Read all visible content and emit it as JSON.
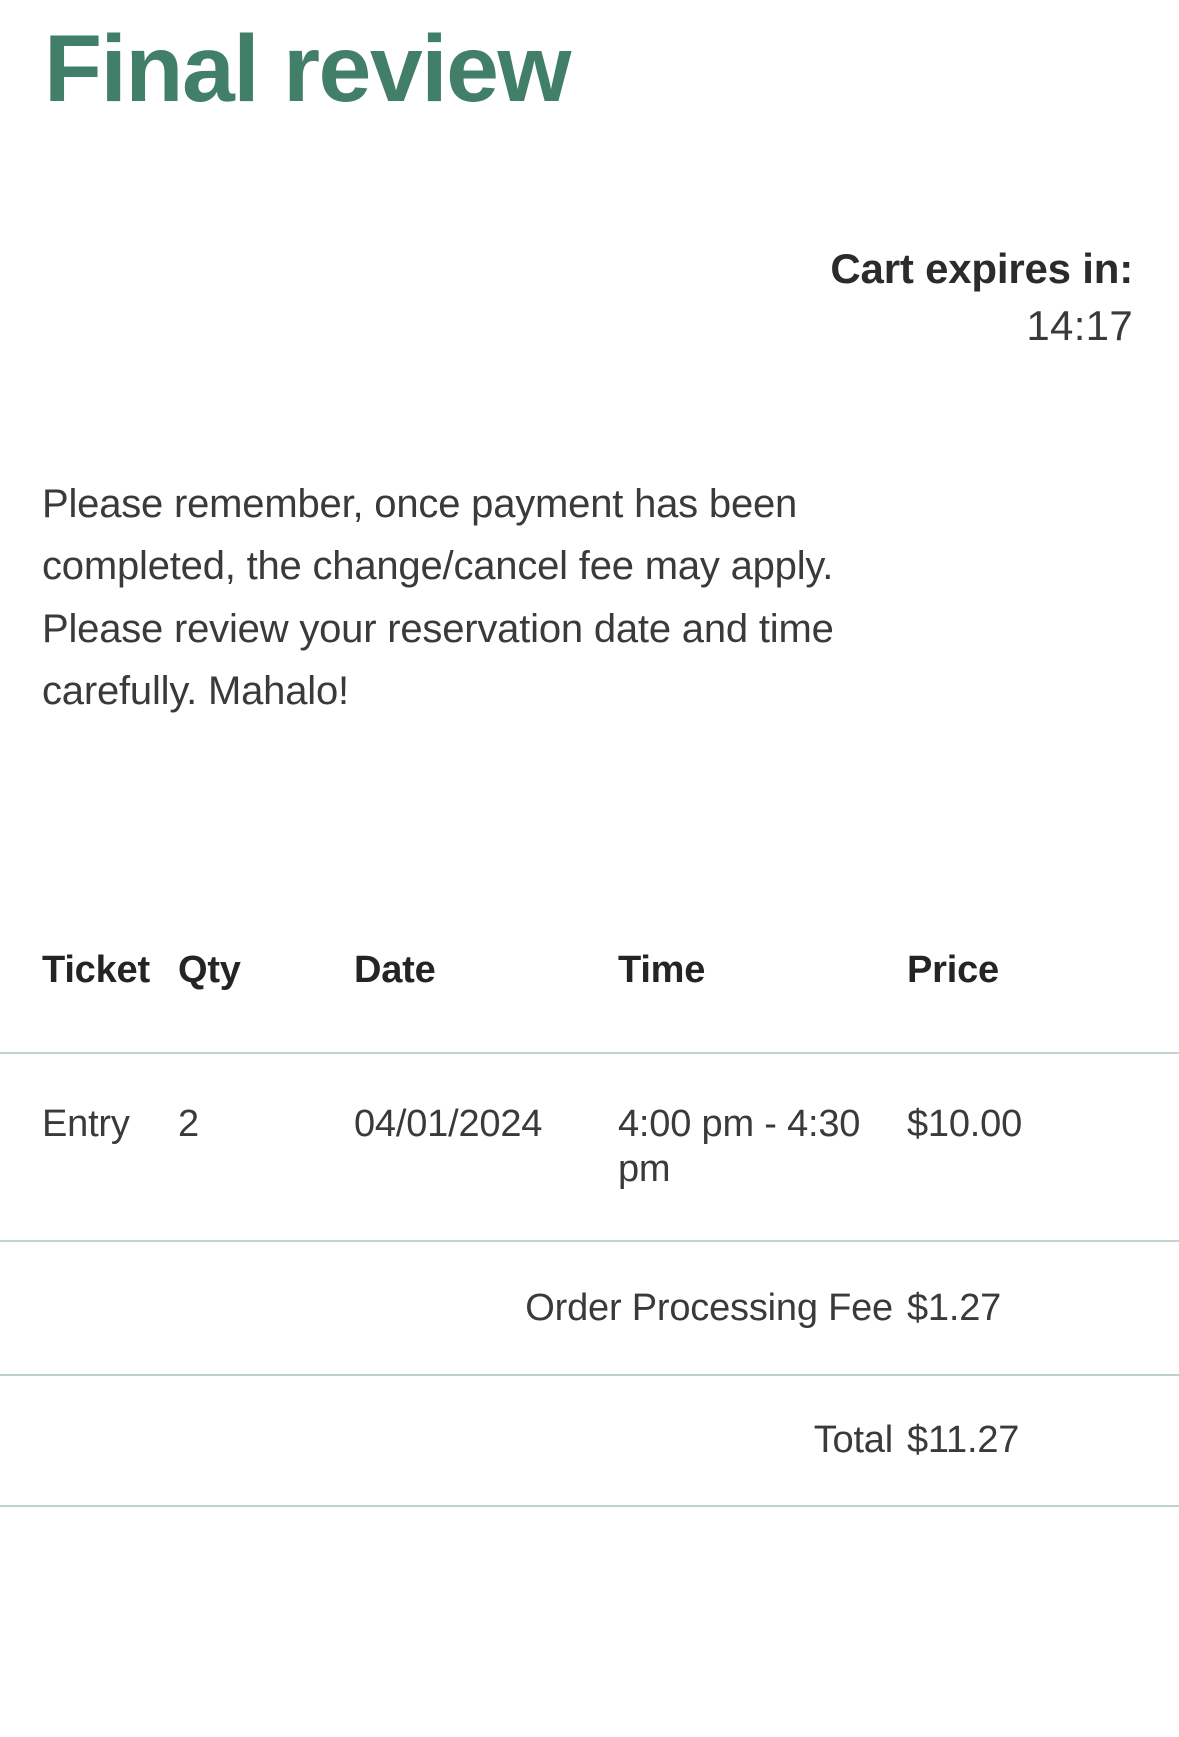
{
  "header": {
    "title": "Final review"
  },
  "cart": {
    "expiry_label": "Cart expires in:",
    "expiry_timer": "14:17"
  },
  "notice": {
    "text": "Please remember, once payment has been completed, the change/cancel fee may apply. Please review your reservation date and time carefully. Mahalo!"
  },
  "order_table": {
    "columns": {
      "ticket": "Ticket",
      "qty": "Qty",
      "date": "Date",
      "time": "Time",
      "price": "Price"
    },
    "rows": [
      {
        "ticket": "Entry",
        "qty": "2",
        "date": "04/01/2024",
        "time": "4:00 pm - 4:30 pm",
        "price": "$10.00"
      }
    ],
    "fee": {
      "label": "Order Processing Fee",
      "amount": "$1.27"
    },
    "total": {
      "label": "Total",
      "amount": "$11.27"
    }
  },
  "colors": {
    "title_green": "#417f68",
    "body_text": "#3a3a3a",
    "rule_grey": "#c4d2d6",
    "rule_green": "#bdd2cd",
    "background": "#ffffff"
  }
}
